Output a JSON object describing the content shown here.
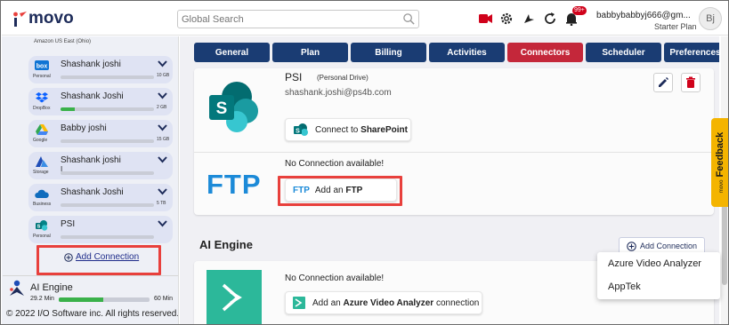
{
  "header": {
    "logo_text": "movo",
    "search_placeholder": "Global Search",
    "notification_count": "99+",
    "user_name": "babbybabbyj666@gm...",
    "user_plan": "Starter Plan",
    "avatar_initials": "Bj"
  },
  "sidebar": {
    "cut_text": "Amazon   US East (Ohio)",
    "accounts": [
      {
        "type": "Personal",
        "name": "Shashank joshi",
        "sub": "",
        "size": "10 GB",
        "usage": 0.0,
        "icon": "box-icon",
        "color": "#0f74d4"
      },
      {
        "type": "DropBox",
        "name": "Shashank Joshi",
        "sub": "",
        "size": "2 GB",
        "usage": 0.15,
        "icon": "dropbox-icon",
        "color": "#0b61ff"
      },
      {
        "type": "Google",
        "name": "Babby joshi",
        "sub": "",
        "size": "15 GB",
        "usage": 0.0,
        "icon": "google-drive-icon",
        "color": "#34a853"
      },
      {
        "type": "Storage",
        "name": "Shashank joshi",
        "sub": "I",
        "size": "",
        "usage": 0.0,
        "icon": "storage-icon",
        "color": "#1e4db7"
      },
      {
        "type": "Business",
        "name": "Shashank Joshi",
        "sub": "",
        "size": "5 TB",
        "usage": 0.0,
        "icon": "onedrive-icon",
        "color": "#0f6cbd"
      },
      {
        "type": "Personal",
        "name": "PSI",
        "sub": "",
        "size": "",
        "usage": 0.0,
        "icon": "sharepoint-icon",
        "color": "#038387"
      }
    ],
    "add_connection": "Add Connection",
    "ai_engine": {
      "label": "AI Engine",
      "used": "29.2 Min",
      "max": "60 Min",
      "usage": 0.49
    },
    "copyright": "© 2022 I/O Software inc. All rights reserved."
  },
  "tabs": [
    "General",
    "Plan",
    "Billing",
    "Activities",
    "Connectors",
    "Scheduler",
    "Preferences"
  ],
  "active_tab": "Connectors",
  "psi_card": {
    "name": "PSI",
    "note": "(Personal Drive)",
    "email": "shashank.joshi@ps4b.com",
    "connect_prefix": "Connect to ",
    "connect_target": "SharePoint"
  },
  "ftp_card": {
    "logo": "FTP",
    "no_connection": "No Connection available!",
    "btn_icon_text": "FTP",
    "btn_prefix": "Add an ",
    "btn_target": "FTP"
  },
  "ai_section": {
    "title": "AI Engine",
    "add_label": "Add Connection",
    "no_connection": "No Connection available!",
    "btn_prefix": "Add an ",
    "btn_target": "Azure Video Analyzer",
    "btn_suffix": " connection"
  },
  "dropdown": [
    "Azure Video Analyzer",
    "AppTek"
  ],
  "feedback": {
    "label": "Feedback",
    "brand": "movo"
  },
  "colors": {
    "nav_blue": "#1a3c73",
    "active_red": "#c4273a",
    "highlight_red": "#e8403c",
    "usage_green": "#3ab14a",
    "feedback_yellow": "#f4b400",
    "ftp_blue": "#1c8ad8",
    "azure_teal": "#2cb89a"
  }
}
